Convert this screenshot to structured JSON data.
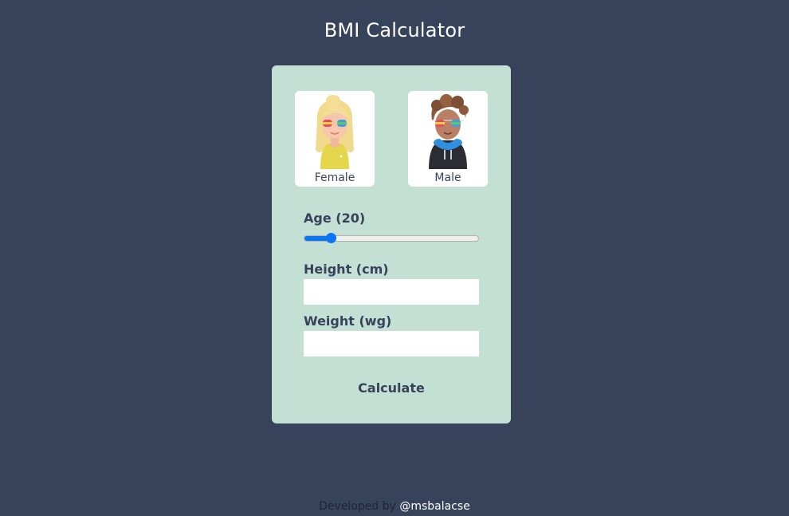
{
  "header": {
    "title": "BMI Calculator"
  },
  "genders": {
    "female": {
      "label": "Female",
      "icon": "female-avatar-icon"
    },
    "male": {
      "label": "Male",
      "icon": "male-avatar-icon"
    }
  },
  "age": {
    "label": "Age (20)",
    "value": 20,
    "fraction": 0.15
  },
  "height": {
    "label": "Height (cm)",
    "value": ""
  },
  "weight": {
    "label": "Weight (wg)",
    "value": ""
  },
  "calculate": {
    "label": "Calculate"
  },
  "footer": {
    "prefix": "Developed by",
    "author": "@msbalacse"
  },
  "colors": {
    "background": "#37435a",
    "card": "#c4dfd3",
    "accent": "#0b75f3"
  }
}
